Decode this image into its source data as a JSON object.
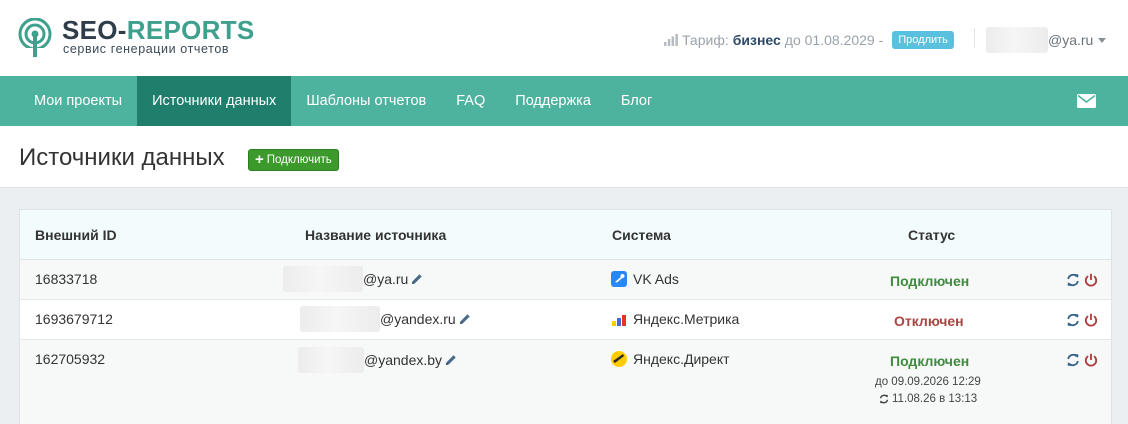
{
  "header": {
    "brand_part1": "SEO-",
    "brand_part2": "REPORTS",
    "brand_subtitle": "сервис генерации отчетов",
    "tariff_label": "Тариф:",
    "tariff_plan": "бизнес",
    "tariff_until": "до 01.08.2029 -",
    "renew_label": "Продлить",
    "user_email_suffix": "@ya.ru"
  },
  "nav": {
    "items": [
      {
        "label": "Мои проекты",
        "active": false
      },
      {
        "label": "Источники данных",
        "active": true
      },
      {
        "label": "Шаблоны отчетов",
        "active": false
      },
      {
        "label": "FAQ",
        "active": false
      },
      {
        "label": "Поддержка",
        "active": false
      },
      {
        "label": "Блог",
        "active": false
      }
    ],
    "mail_icon": "envelope-icon"
  },
  "page": {
    "title": "Источники данных",
    "connect_label": "Подключить"
  },
  "table": {
    "headers": {
      "external_id": "Внешний ID",
      "source_name": "Название источника",
      "system": "Система",
      "status": "Статус"
    },
    "rows": [
      {
        "external_id": "16833718",
        "name_suffix": "@ya.ru",
        "system": "VK Ads",
        "system_icon": "vk-ads-icon",
        "status": "Подключен",
        "status_type": "connected"
      },
      {
        "external_id": "1693679712",
        "name_suffix": "@yandex.ru",
        "system": "Яндекс.Метрика",
        "system_icon": "yandex-metrika-icon",
        "status": "Отключен",
        "status_type": "disconnected"
      },
      {
        "external_id": "162705932",
        "name_suffix": "@yandex.by",
        "system": "Яндекс.Директ",
        "system_icon": "yandex-direct-icon",
        "status": "Подключен",
        "status_type": "connected",
        "status_until": "до 09.09.2026 12:29",
        "status_synced": "11.08.26 в 13:13"
      }
    ]
  },
  "colors": {
    "nav_bg": "#4db39f",
    "nav_active": "#1f7e6c",
    "connected": "#3c8d3c",
    "disconnected": "#a94442",
    "renew_btn": "#5bc0de",
    "connect_btn": "#3c9a2c"
  }
}
